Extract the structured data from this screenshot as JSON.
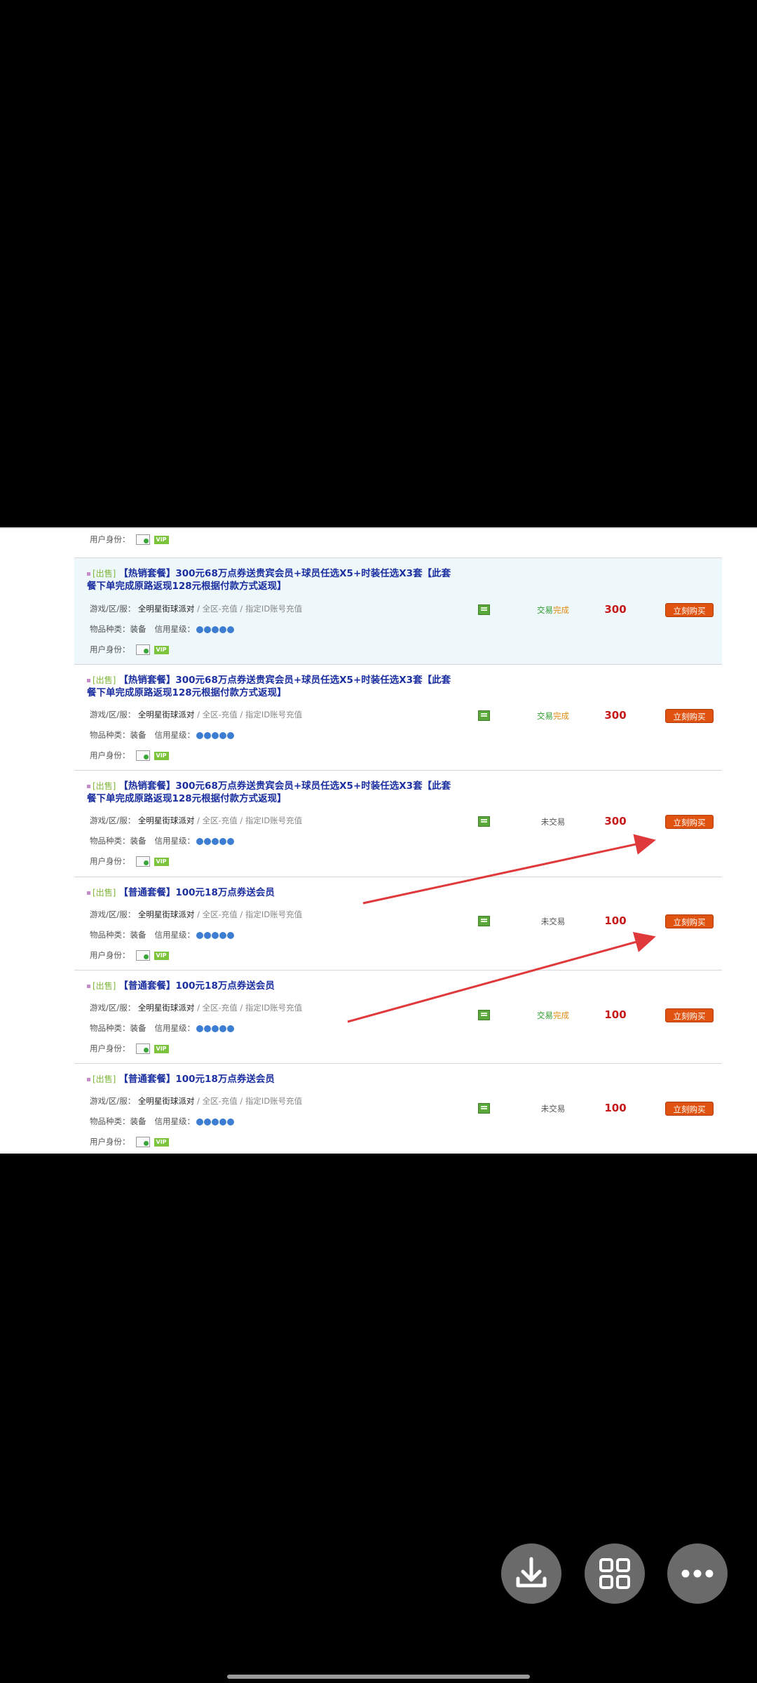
{
  "listings": [
    {
      "title": "",
      "tag": "",
      "game_label": "",
      "game_name": "",
      "game_zone": "",
      "item_label": "",
      "item_type": "",
      "credit_label": "",
      "user_label": "用户身份：",
      "status": "",
      "price": "",
      "buy_label": "",
      "partial": true
    },
    {
      "tag": "[出售]",
      "title": "【热销套餐】300元68万点券送贵宾会员+球员任选X5+时装任选X3套【此套餐下单完成原路返现128元根据付款方式返现】",
      "game_label": "游戏/区/服：",
      "game_name": "全明星街球派对",
      "game_zone": "/ 全区-充值 / 指定ID账号充值",
      "item_label": "物品种类：",
      "item_type": "装备",
      "credit_label": "信用星级：",
      "user_label": "用户身份：",
      "status": "交易完成",
      "price": "300",
      "buy_label": "立刻购买"
    },
    {
      "tag": "[出售]",
      "title": "【热销套餐】300元68万点券送贵宾会员+球员任选X5+时装任选X3套【此套餐下单完成原路返现128元根据付款方式返现】",
      "game_label": "游戏/区/服：",
      "game_name": "全明星街球派对",
      "game_zone": "/ 全区-充值 / 指定ID账号充值",
      "item_label": "物品种类：",
      "item_type": "装备",
      "credit_label": "信用星级：",
      "user_label": "用户身份：",
      "status": "交易完成",
      "price": "300",
      "buy_label": "立刻购买"
    },
    {
      "tag": "[出售]",
      "title": "【热销套餐】300元68万点券送贵宾会员+球员任选X5+时装任选X3套【此套餐下单完成原路返现128元根据付款方式返现】",
      "game_label": "游戏/区/服：",
      "game_name": "全明星街球派对",
      "game_zone": "/ 全区-充值 / 指定ID账号充值",
      "item_label": "物品种类：",
      "item_type": "装备",
      "credit_label": "信用星级：",
      "user_label": "用户身份：",
      "status": "未交易",
      "price": "300",
      "buy_label": "立刻购买"
    },
    {
      "tag": "[出售]",
      "title": "【普通套餐】100元18万点券送会员",
      "game_label": "游戏/区/服：",
      "game_name": "全明星街球派对",
      "game_zone": "/ 全区-充值 / 指定ID账号充值",
      "item_label": "物品种类：",
      "item_type": "装备",
      "credit_label": "信用星级：",
      "user_label": "用户身份：",
      "status": "未交易",
      "price": "100",
      "buy_label": "立刻购买"
    },
    {
      "tag": "[出售]",
      "title": "【普通套餐】100元18万点券送会员",
      "game_label": "游戏/区/服：",
      "game_name": "全明星街球派对",
      "game_zone": "/ 全区-充值 / 指定ID账号充值",
      "item_label": "物品种类：",
      "item_type": "装备",
      "credit_label": "信用星级：",
      "user_label": "用户身份：",
      "status": "交易完成",
      "price": "100",
      "buy_label": "立刻购买"
    },
    {
      "tag": "[出售]",
      "title": "【普通套餐】100元18万点券送会员",
      "game_label": "游戏/区/服：",
      "game_name": "全明星街球派对",
      "game_zone": "/ 全区-充值 / 指定ID账号充值",
      "item_label": "物品种类：",
      "item_type": "装备",
      "credit_label": "信用星级：",
      "user_label": "用户身份：",
      "status": "未交易",
      "price": "100",
      "buy_label": "立刻购买"
    }
  ],
  "badges": {
    "vip": "VIP"
  },
  "colors": {
    "accent_button": "#e0520f",
    "price": "#c61a1a",
    "title": "#1b2fa0",
    "status_done": "#2a9a2a",
    "highlight_row": "#eef8fb",
    "annotation_arrow": "#e0393c"
  },
  "viewer_actions": [
    {
      "name": "download",
      "icon": "download-icon"
    },
    {
      "name": "grid",
      "icon": "grid-icon"
    },
    {
      "name": "more",
      "icon": "more-dots-icon"
    }
  ]
}
